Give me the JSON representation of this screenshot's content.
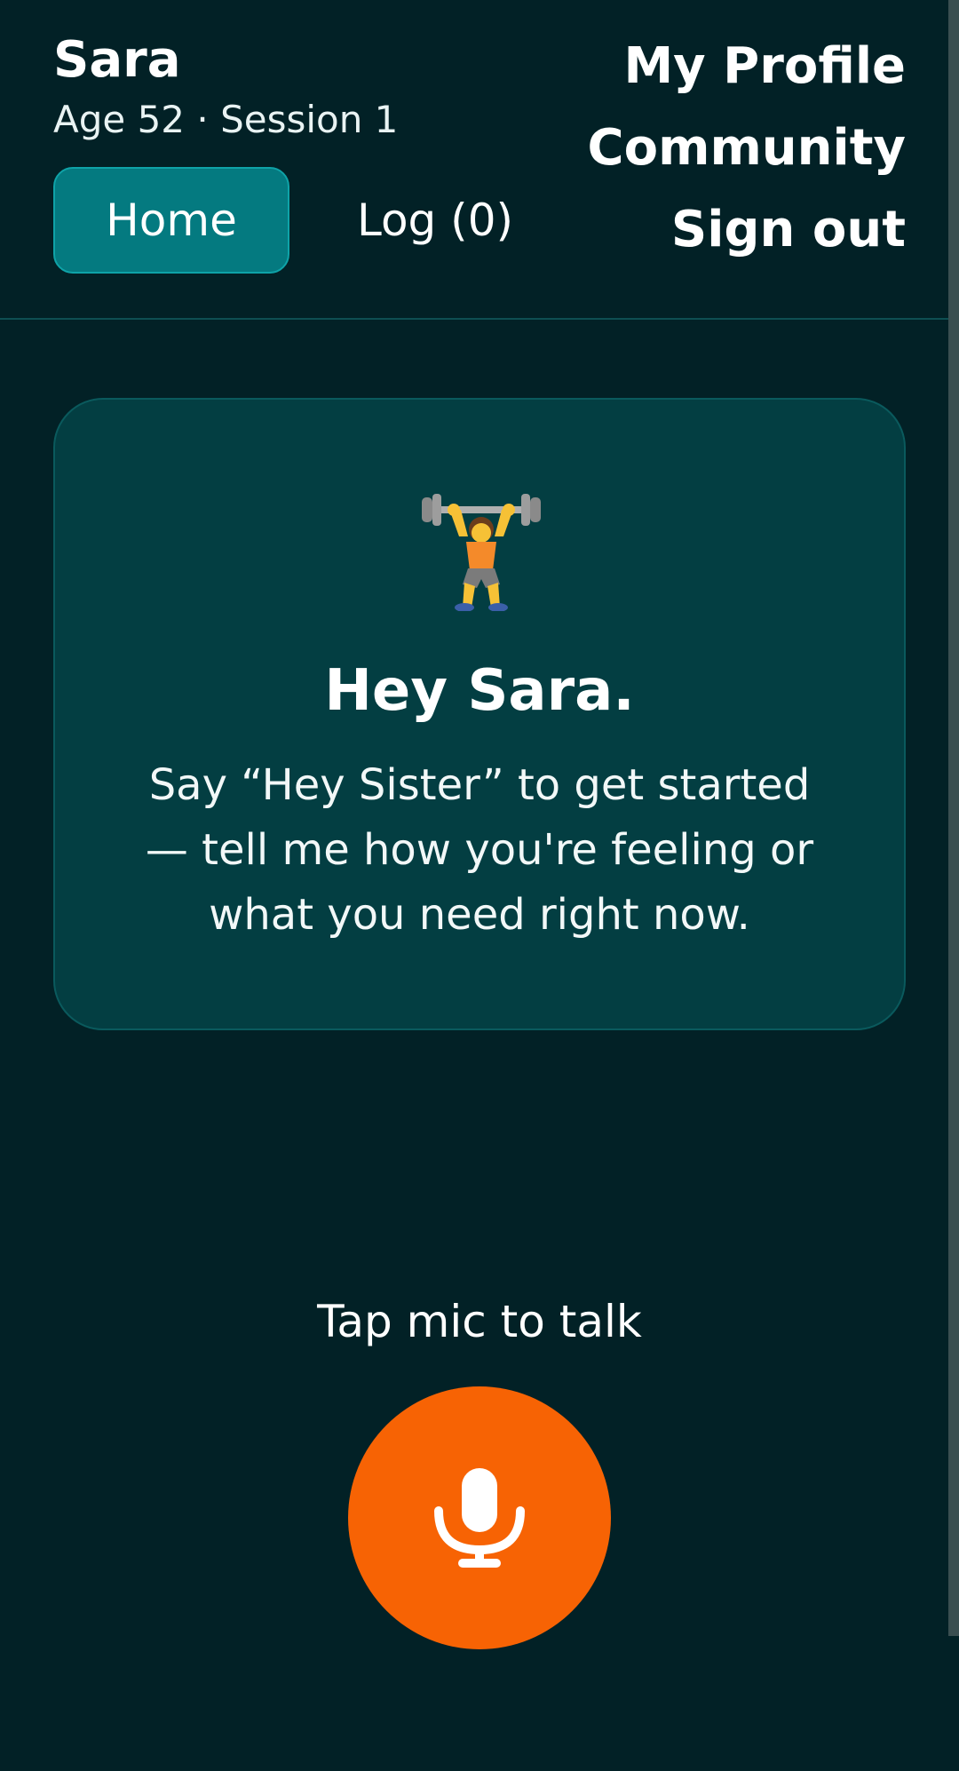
{
  "header": {
    "user_name": "Sara",
    "user_meta": "Age 52 · Session 1",
    "tabs": [
      {
        "label": "Home",
        "active": true
      },
      {
        "label": "Log (0)",
        "active": false
      }
    ],
    "nav": {
      "profile": "My Profile",
      "community": "Community",
      "sign_out": "Sign out"
    }
  },
  "card": {
    "icon": "weightlifting-person-icon",
    "title": "Hey Sara.",
    "text": "Say “Hey Sister” to get started — tell me how you're feeling or what you need right now."
  },
  "mic": {
    "prompt": "Tap mic to talk",
    "icon": "microphone-icon"
  },
  "colors": {
    "background": "#022126",
    "card": "#033e42",
    "active_tab": "#047a80",
    "mic_button": "#f76304"
  }
}
